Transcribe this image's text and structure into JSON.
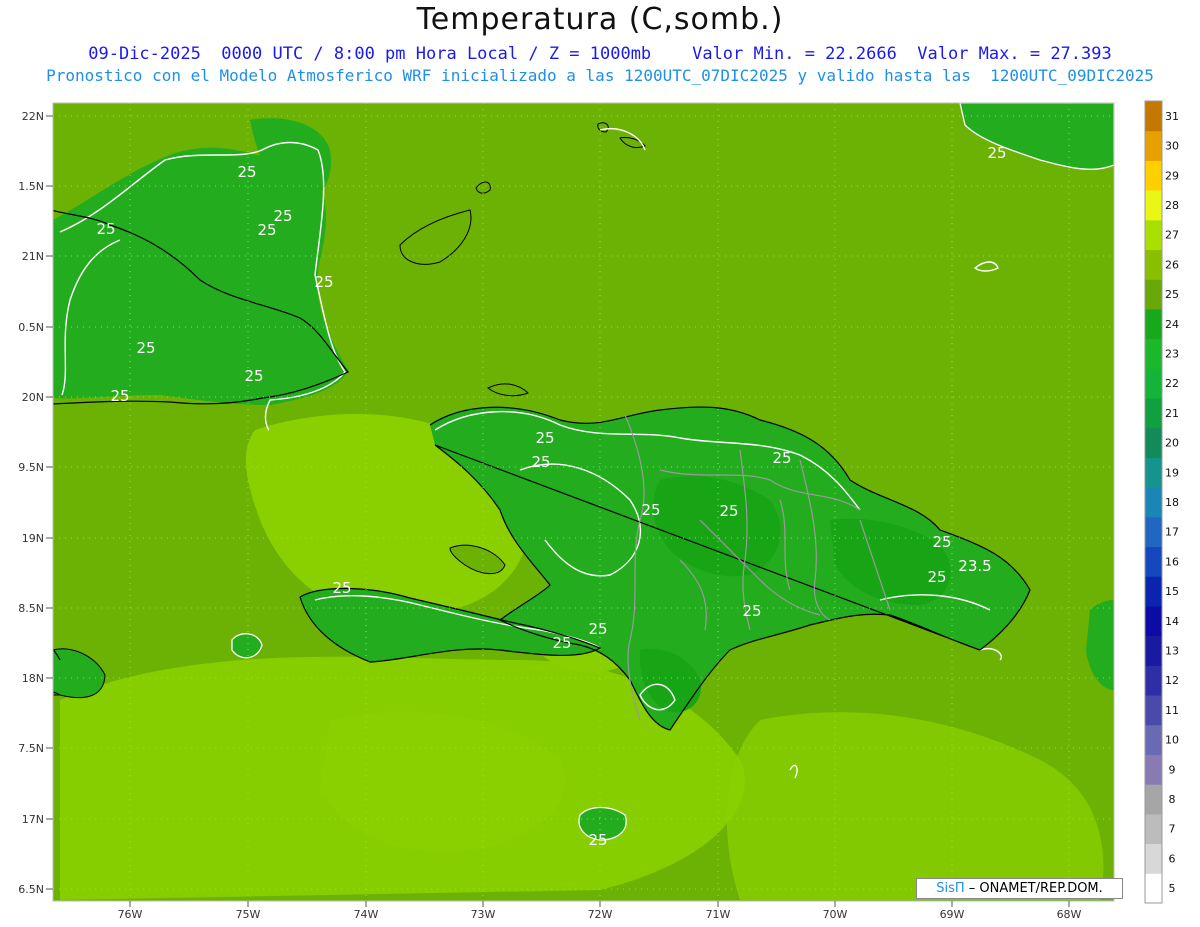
{
  "title": "Temperatura (C,somb.)",
  "subtitle_line1": "09-Dic-2025  0000 UTC / 8:00 pm Hora Local / Z = 1000mb    Valor Min. = 22.2666  Valor Max. = 27.393",
  "subtitle_line2": "Pronostico con el Modelo Atmosferico WRF inicializado a las 1200UTC_07DIC2025 y valido hasta las  1200UTC_09DIC2025",
  "credit": {
    "brand": "SisΠ",
    "rest": "– ONAMET/REP.DOM."
  },
  "latitude_labels": [
    "22N",
    "1.5N",
    "21N",
    "0.5N",
    "20N",
    "9.5N",
    "19N",
    "8.5N",
    "18N",
    "7.5N",
    "17N",
    "6.5N"
  ],
  "longitude_labels": [
    "76W",
    "75W",
    "74W",
    "73W",
    "72W",
    "71W",
    "70W",
    "69W",
    "68W"
  ],
  "colorbar": {
    "labels": [
      "5",
      "6",
      "7",
      "8",
      "9",
      "10",
      "11",
      "12",
      "13",
      "14",
      "15",
      "16",
      "17",
      "18",
      "19",
      "20",
      "21",
      "22",
      "23",
      "24",
      "25",
      "26",
      "27",
      "28",
      "29",
      "30",
      "31"
    ],
    "colors": [
      "#ffffff",
      "#d8d8d8",
      "#bcbcbc",
      "#a6a6a6",
      "#8a7ab2",
      "#6a6ab4",
      "#4a4aaa",
      "#2e2ea6",
      "#1a1aa0",
      "#0c0ca4",
      "#0a24b0",
      "#1448bc",
      "#2066c2",
      "#1a86b6",
      "#14948c",
      "#128a5a",
      "#10a040",
      "#14b438",
      "#1ab82a",
      "#18a81c",
      "#6aa80a",
      "#88c000",
      "#aae000",
      "#e8f814",
      "#ffd000",
      "#e8a000",
      "#c47800"
    ]
  },
  "contour_labels": [
    "25",
    "25",
    "25",
    "25",
    "25",
    "25",
    "25",
    "25",
    "25",
    "25",
    "25",
    "25",
    "25",
    "25",
    "25",
    "25",
    "25",
    "25",
    "25",
    "23.5",
    "25",
    "25"
  ],
  "colors": {
    "ocean_base": "#6cb204",
    "warm_ocean": "#8ad000",
    "land_base": "#22ac1e",
    "cool_land": "#17a415",
    "contour": "#ffffff",
    "coast": "#000000",
    "border": "#999999"
  }
}
